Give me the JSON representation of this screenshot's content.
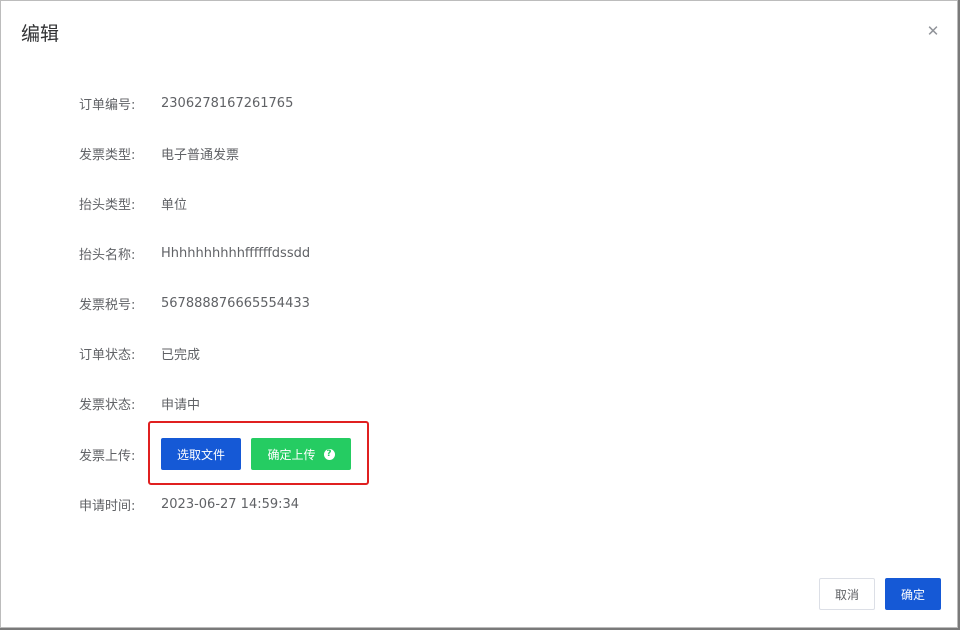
{
  "dialog": {
    "title": "编辑",
    "close_icon": "close-icon",
    "close_glyph": "✕"
  },
  "fields": [
    {
      "label": "订单编号:",
      "value": "2306278167261765"
    },
    {
      "label": "发票类型:",
      "value": "电子普通发票"
    },
    {
      "label": "抬头类型:",
      "value": "单位"
    },
    {
      "label": "抬头名称:",
      "value": "Hhhhhhhhhhffffffdssdd"
    },
    {
      "label": "发票税号:",
      "value": "567888876665554433"
    },
    {
      "label": "订单状态:",
      "value": "已完成"
    },
    {
      "label": "发票状态:",
      "value": "申请中"
    }
  ],
  "upload": {
    "label": "发票上传:",
    "select_button": "选取文件",
    "upload_button": "确定上传",
    "help_icon": "question-circle-icon",
    "help_glyph": "?"
  },
  "apply_time": {
    "label": "申请时间:",
    "value": "2023-06-27 14:59:34"
  },
  "footer": {
    "cancel": "取消",
    "confirm": "确定"
  },
  "colors": {
    "primary": "#1559d6",
    "success": "#25cc62",
    "highlight_border": "#e02020"
  }
}
